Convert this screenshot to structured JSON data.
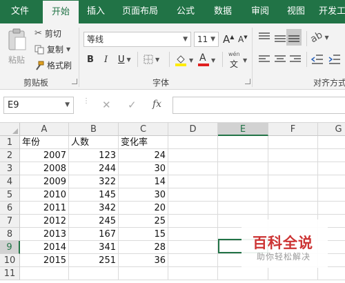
{
  "ribbon_tabs": {
    "file": "文件",
    "home": "开始",
    "insert": "插入",
    "page_layout": "页面布局",
    "formulas": "公式",
    "data": "数据",
    "review": "审阅",
    "view": "视图",
    "developer": "开发工"
  },
  "clipboard": {
    "paste": "粘贴",
    "cut": "剪切",
    "copy": "复制",
    "format_painter": "格式刷",
    "group_label": "剪贴板"
  },
  "font": {
    "name": "等线",
    "size": "11",
    "grow": "A",
    "shrink": "A",
    "bold": "B",
    "italic": "I",
    "underline": "U",
    "font_color_letter": "A",
    "phonetic_top": "wén",
    "phonetic_bottom": "文",
    "group_label": "字体",
    "highlight_color": "#ffeb00",
    "font_color": "#e02020"
  },
  "alignment": {
    "group_label": "对齐方式"
  },
  "formula_bar": {
    "name_box": "E9",
    "cancel": "✕",
    "enter": "✓",
    "fx": "fx",
    "formula": ""
  },
  "columns": [
    "A",
    "B",
    "C",
    "D",
    "E",
    "F",
    "G"
  ],
  "rows": [
    "1",
    "2",
    "3",
    "4",
    "5",
    "6",
    "7",
    "8",
    "9",
    "10",
    "11"
  ],
  "table": {
    "headers": [
      "年份",
      "人数",
      "变化率"
    ],
    "data": [
      [
        "2007",
        "123",
        "24"
      ],
      [
        "2008",
        "244",
        "30"
      ],
      [
        "2009",
        "322",
        "14"
      ],
      [
        "2010",
        "145",
        "30"
      ],
      [
        "2011",
        "342",
        "20"
      ],
      [
        "2012",
        "245",
        "25"
      ],
      [
        "2013",
        "167",
        "15"
      ],
      [
        "2014",
        "341",
        "28"
      ],
      [
        "2015",
        "251",
        "36"
      ]
    ]
  },
  "selection": {
    "column": "E",
    "row": "9"
  },
  "watermark": {
    "title": "百科全说",
    "subtitle": "助你轻松解决"
  },
  "colors": {
    "accent": "#217346",
    "watermark_red": "#cc3333"
  }
}
